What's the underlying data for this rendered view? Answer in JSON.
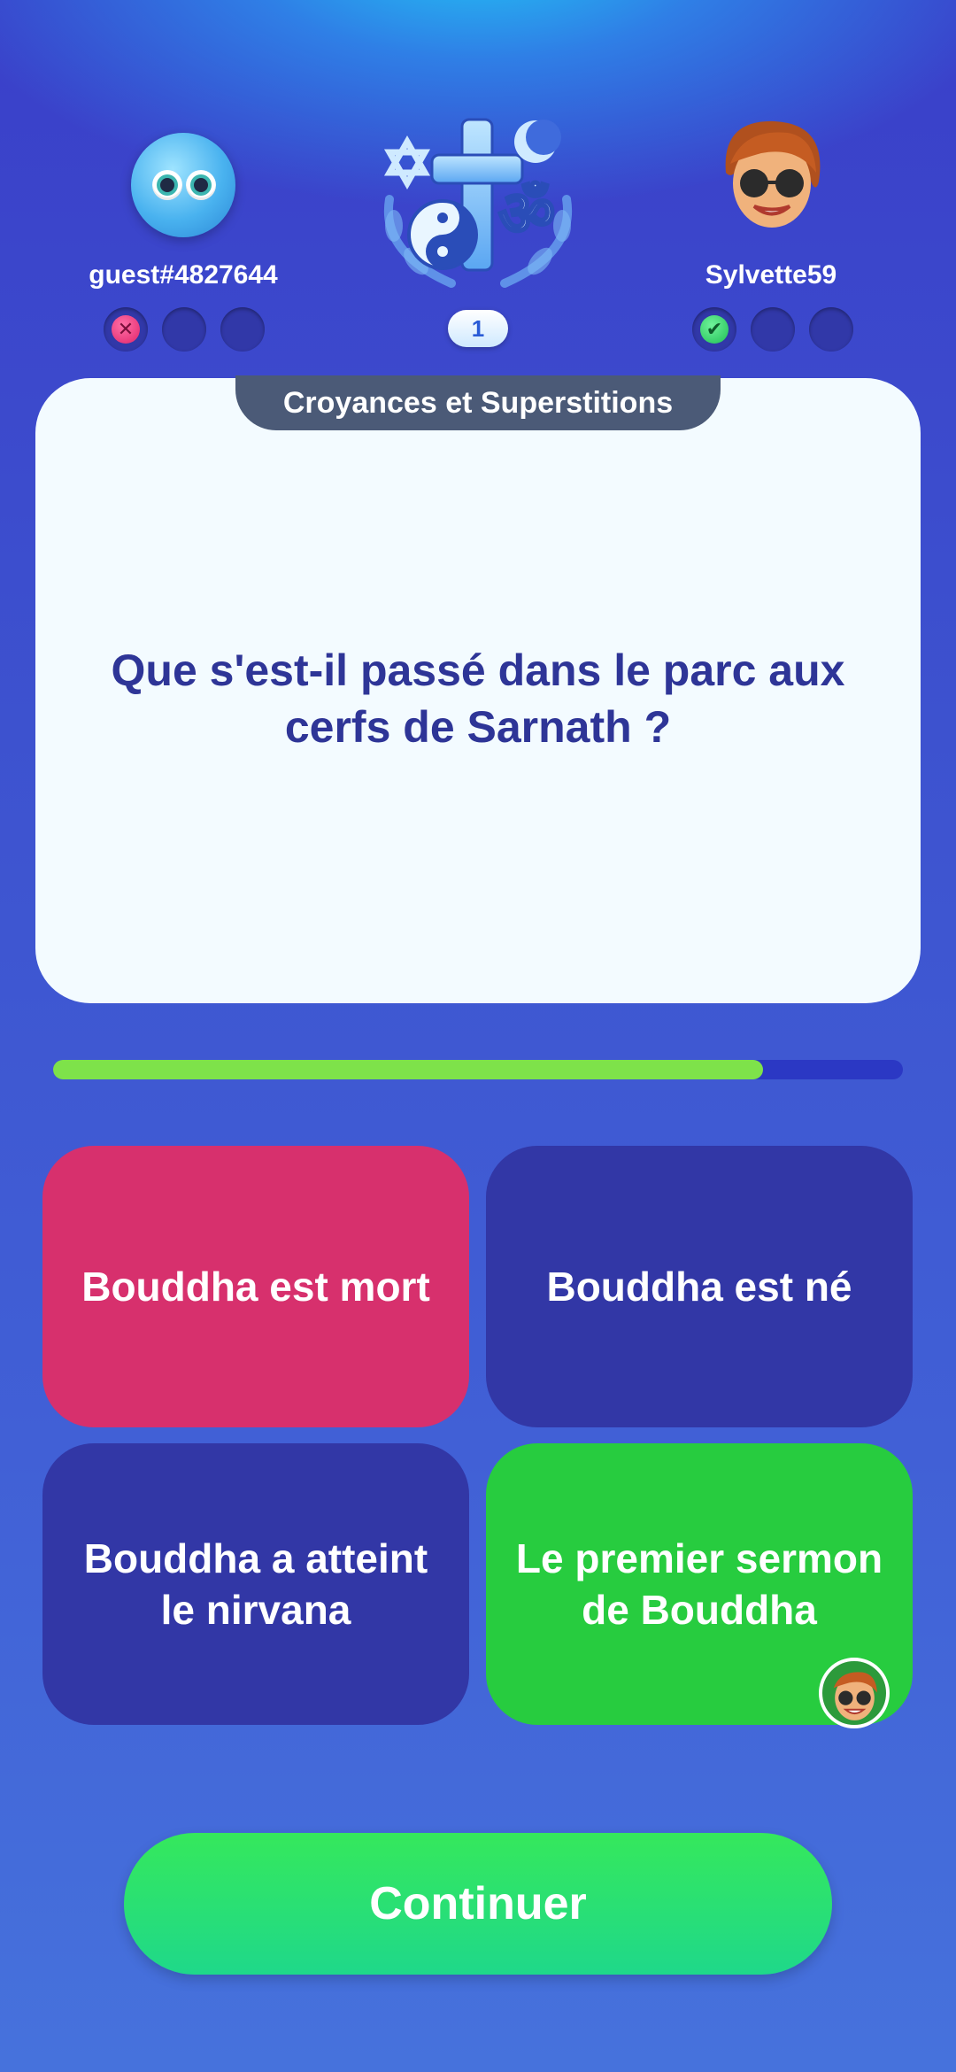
{
  "players": {
    "left": {
      "name": "guest#4827644",
      "results": [
        "wrong",
        "empty",
        "empty"
      ]
    },
    "right": {
      "name": "Sylvette59",
      "results": [
        "right",
        "empty",
        "empty"
      ]
    }
  },
  "round": {
    "number": "1"
  },
  "question": {
    "category": "Croyances et Superstitions",
    "text": "Que s'est-il passé dans le parc aux cerfs de Sarnath ?"
  },
  "timer": {
    "remaining_fraction": 0.835
  },
  "answers": [
    {
      "label": "Bouddha est mort",
      "state": "wrong-selected",
      "color": "#d7306d"
    },
    {
      "label": "Bouddha est né",
      "state": "neutral",
      "color": "#3237a6"
    },
    {
      "label": "Bouddha a atteint le nirvana",
      "state": "neutral",
      "color": "#3237a6"
    },
    {
      "label": "Le premier sermon de Bouddha",
      "state": "correct",
      "color": "#27cc3f"
    }
  ],
  "continue_button": {
    "label": "Continuer"
  },
  "icons": {
    "left_avatar": "blob-eyes-avatar-icon",
    "right_avatar": "woman-sunglasses-avatar-icon",
    "category": "religion-symbols-icon",
    "wrong": "x-mark-icon",
    "right": "check-mark-icon"
  }
}
